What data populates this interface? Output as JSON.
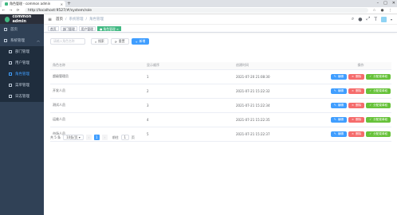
{
  "browser": {
    "tab_title": "角色管理 - common admin",
    "url": "http://localhost:9527/#/system/role"
  },
  "sidebar": {
    "logo": "common admin",
    "items": [
      {
        "label": "首页"
      },
      {
        "label": "系统管理"
      }
    ],
    "subitems": [
      {
        "label": "部门管理"
      },
      {
        "label": "用户管理"
      },
      {
        "label": "角色管理"
      },
      {
        "label": "菜单管理"
      },
      {
        "label": "日志管理"
      }
    ]
  },
  "navbar": {
    "crumbs": [
      "首页",
      "/",
      "系统管理",
      "/",
      "角色管理"
    ]
  },
  "tags": [
    "首页",
    "部门管理",
    "用户管理",
    "角色管理"
  ],
  "search": {
    "placeholder": "请输入角色名称",
    "search_label": "搜索",
    "reset_label": "重置",
    "add_label": "新增"
  },
  "table": {
    "headers": [
      "角色名称",
      "显示顺序",
      "创建时间",
      "操作"
    ],
    "rows": [
      {
        "name": "超级管理员",
        "order": "1",
        "time": "2021-07-20 21:08:30"
      },
      {
        "name": "开发人员",
        "order": "2",
        "time": "2021-07-21 15:22:32"
      },
      {
        "name": "测试人员",
        "order": "3",
        "time": "2021-07-21 15:22:34"
      },
      {
        "name": "运维人员",
        "order": "4",
        "time": "2021-07-21 15:22:35"
      },
      {
        "name": "市场人员",
        "order": "5",
        "time": "2021-07-21 15:22:37"
      }
    ],
    "edit_label": "编辑",
    "delete_label": "删除",
    "perm_label": "分配菜单权"
  },
  "pager": {
    "total": "共 5 条",
    "size": "10条/页",
    "current": "1",
    "goto": "前往",
    "page_input": "1",
    "page_unit": "页"
  }
}
